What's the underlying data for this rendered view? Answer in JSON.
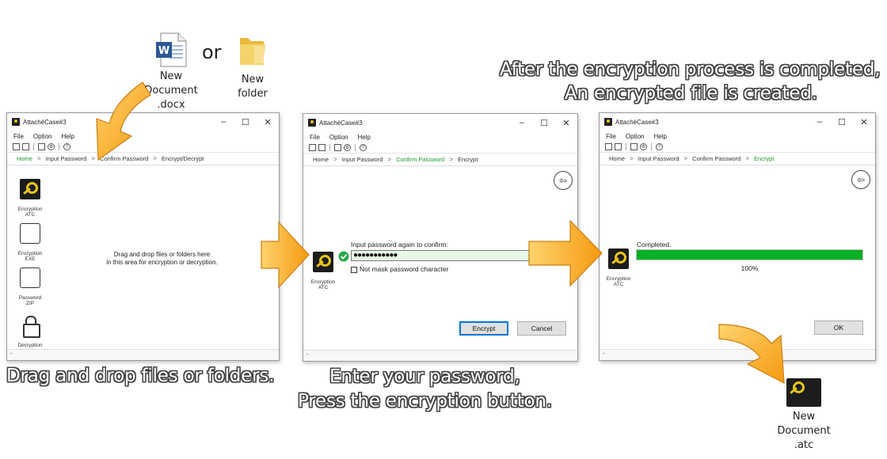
{
  "desktop": {
    "word_file": {
      "label": "New\nDocument\n.docx",
      "icon": "word-document-icon"
    },
    "or_text": "or",
    "folder": {
      "label": "New\nfolder",
      "icon": "folder-icon"
    },
    "output_file": {
      "label": "New\nDocument\n.atc",
      "icon": "atc-key-file-icon"
    }
  },
  "captions": {
    "step1": "Drag and drop files or folders.",
    "step2_line1": "Enter your password,",
    "step2_line2": "Press the encryption button.",
    "step3_line1": "After the encryption process is completed,",
    "step3_line2": "An encrypted file is created."
  },
  "window_common": {
    "title": "AttachéCase#3",
    "menu": [
      "File",
      "Option",
      "Help"
    ],
    "minimize": "–",
    "maximize": "☐",
    "close": "✕"
  },
  "win1": {
    "breadcrumb": [
      "Home",
      "Input Password",
      "Confirm Password",
      "Encrypt/Decrypt"
    ],
    "current_step": 0,
    "sidebar": [
      {
        "label": "Encryption\nATC",
        "icon": "atc-encryption-icon"
      },
      {
        "label": "Encryption\nEXE",
        "icon": "exe-encryption-icon"
      },
      {
        "label": "Password\nZIP",
        "icon": "zip-password-icon"
      },
      {
        "label": "Decryption",
        "icon": "lock-icon"
      }
    ],
    "drop_hint_line1": "Drag and drop files or folders here",
    "drop_hint_line2": "in this area for encryption or decryption."
  },
  "win2": {
    "breadcrumb": [
      "Home",
      "Input Password",
      "Confirm Password",
      "Encrypt"
    ],
    "current_step": 2,
    "mode_label": "Encryption\nATC",
    "prompt": "Input password again to confirm:",
    "password_mask": "●●●●●●●●●●●",
    "checkbox_label": "Not mask password character",
    "checkbox_checked": false,
    "encrypt_button": "Encrypt",
    "cancel_button": "Cancel",
    "colors": {
      "ok_check": "#2aa84a",
      "field_bg": "#e8f7e8"
    }
  },
  "win3": {
    "breadcrumb": [
      "Home",
      "Input Password",
      "Confirm Password",
      "Encrypt"
    ],
    "current_step": 3,
    "mode_label": "Encryption\nATC",
    "status": "Completed.",
    "progress_percent": 100,
    "progress_text": "100%",
    "ok_button": "OK",
    "colors": {
      "progress": "#06b025"
    }
  },
  "colors": {
    "arrow": "#f7a21b",
    "breadcrumb_current": "#1a9a2a"
  }
}
